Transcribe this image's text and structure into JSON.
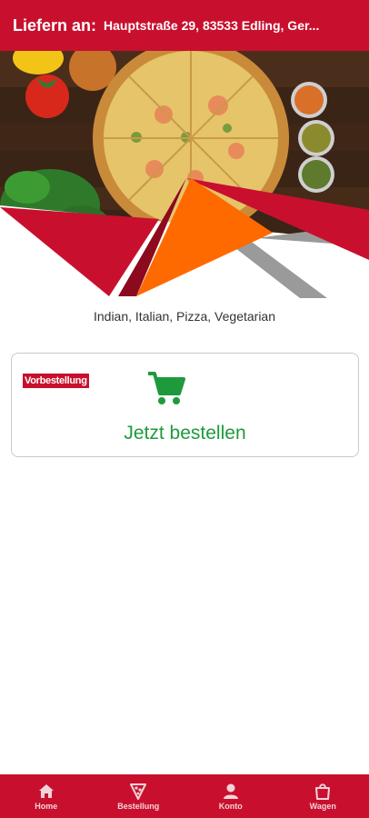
{
  "header": {
    "deliver_label": "Liefern an:",
    "address": "Hauptstraße 29, 83533 Edling, Ger..."
  },
  "restaurant": {
    "cuisines": "Indian, Italian, Pizza, Vegetarian"
  },
  "order_card": {
    "preorder_badge": "Vorbestellung",
    "order_now_label": "Jetzt bestellen"
  },
  "bottom_nav": {
    "items": [
      {
        "label": "Home",
        "icon": "home-icon"
      },
      {
        "label": "Bestellung",
        "icon": "pizza-slice-icon"
      },
      {
        "label": "Konto",
        "icon": "user-icon"
      },
      {
        "label": "Wagen",
        "icon": "shopping-bag-icon"
      }
    ]
  },
  "colors": {
    "brand_red": "#c8102e",
    "accent_orange": "#ff6a00",
    "order_green": "#1e9a3d"
  }
}
